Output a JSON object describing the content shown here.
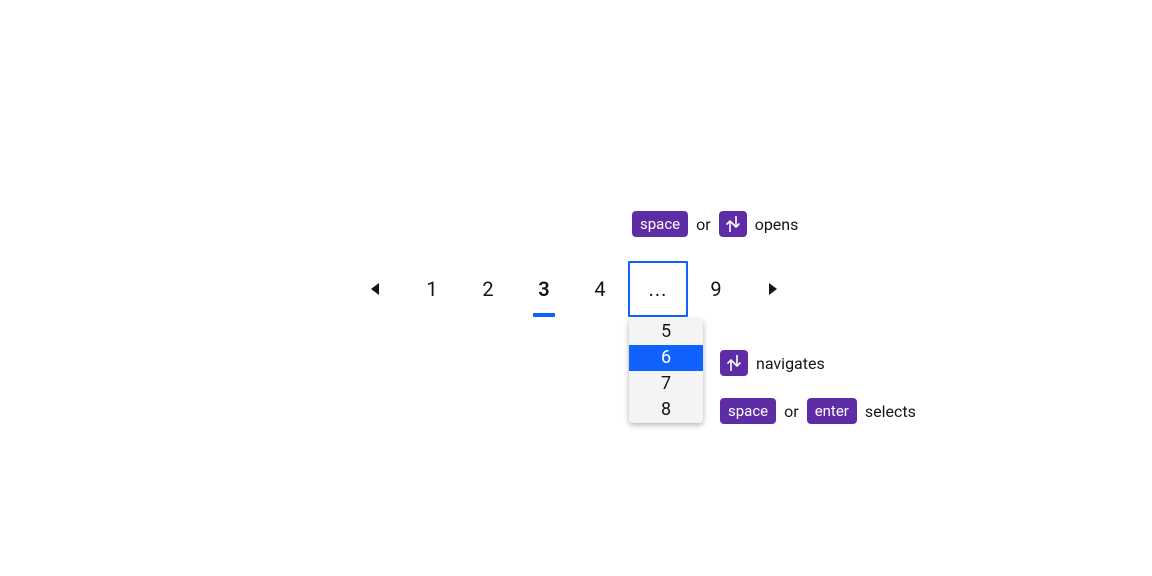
{
  "pagination": {
    "prev_icon": "triangle-left",
    "next_icon": "triangle-right",
    "pages": [
      "1",
      "2",
      "3",
      "4"
    ],
    "current": "3",
    "overflow_label": "...",
    "last": "9",
    "overflow_menu": [
      "5",
      "6",
      "7",
      "8"
    ],
    "overflow_selected": "6"
  },
  "hints": {
    "open": {
      "key1": "space",
      "or": "or",
      "key2_icon": "updown",
      "text": "opens"
    },
    "nav": {
      "key_icon": "updown",
      "text": "navigates"
    },
    "select": {
      "key1": "space",
      "or": "or",
      "key2": "enter",
      "text": "selects"
    }
  }
}
